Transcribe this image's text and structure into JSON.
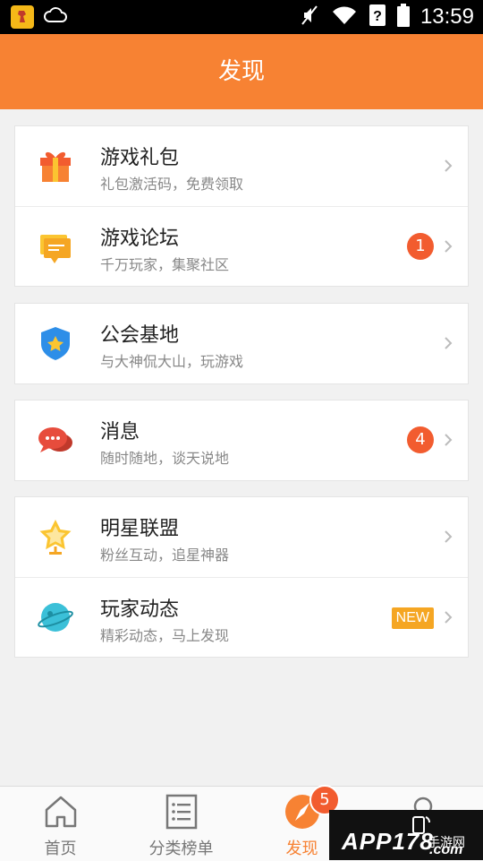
{
  "status_bar": {
    "time": "13:59"
  },
  "header": {
    "title": "发现"
  },
  "sections": [
    {
      "rows": [
        {
          "icon": "gift-icon",
          "title": "游戏礼包",
          "subtitle": "礼包激活码，免费领取"
        },
        {
          "icon": "forum-icon",
          "title": "游戏论坛",
          "subtitle": "千万玩家，集聚社区",
          "badge": "1"
        }
      ]
    },
    {
      "rows": [
        {
          "icon": "guild-shield-icon",
          "title": "公会基地",
          "subtitle": "与大神侃大山，玩游戏"
        }
      ]
    },
    {
      "rows": [
        {
          "icon": "message-bubble-icon",
          "title": "消息",
          "subtitle": "随时随地，谈天说地",
          "badge": "4"
        }
      ]
    },
    {
      "rows": [
        {
          "icon": "star-trophy-icon",
          "title": "明星联盟",
          "subtitle": "粉丝互动，追星神器"
        },
        {
          "icon": "planet-icon",
          "title": "玩家动态",
          "subtitle": "精彩动态，马上发现",
          "tag": "NEW"
        }
      ]
    }
  ],
  "bottom_nav": {
    "tabs": [
      {
        "label": "首页",
        "icon": "home-icon"
      },
      {
        "label": "分类榜单",
        "icon": "list-icon"
      },
      {
        "label": "发现",
        "icon": "compass-icon",
        "active": true,
        "badge": "5"
      },
      {
        "label": "",
        "icon": "profile-icon"
      }
    ]
  },
  "watermark": {
    "text": "APP178",
    "sub": "手游网",
    "domain": ".com"
  },
  "colors": {
    "accent": "#f78233",
    "badge": "#f25c2f",
    "new_tag": "#f5a623"
  }
}
